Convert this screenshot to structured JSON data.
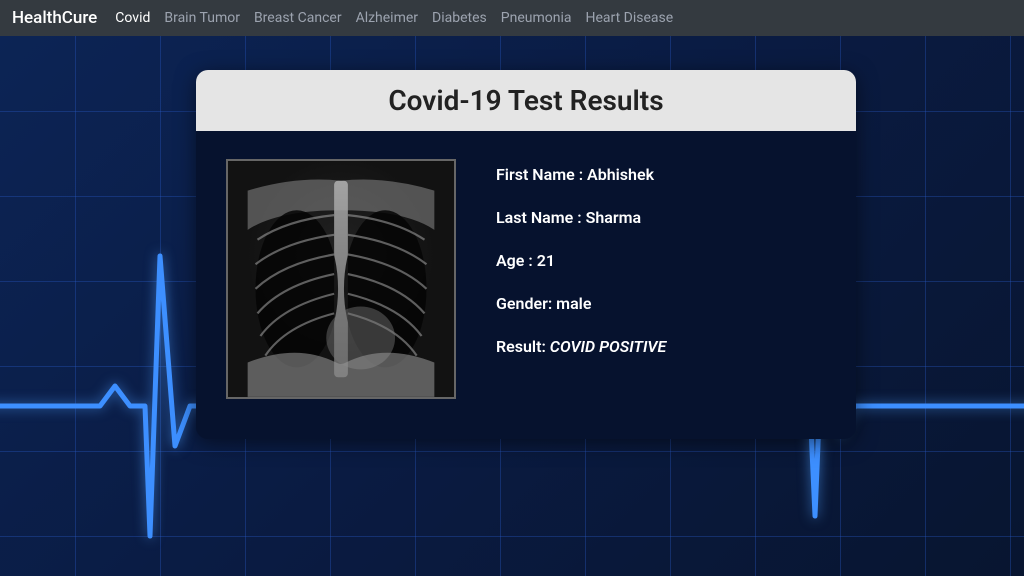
{
  "navbar": {
    "brand": "HealthCure",
    "links": [
      {
        "label": "Covid",
        "active": true
      },
      {
        "label": "Brain Tumor",
        "active": false
      },
      {
        "label": "Breast Cancer",
        "active": false
      },
      {
        "label": "Alzheimer",
        "active": false
      },
      {
        "label": "Diabetes",
        "active": false
      },
      {
        "label": "Pneumonia",
        "active": false
      },
      {
        "label": "Heart Disease",
        "active": false
      }
    ]
  },
  "card": {
    "title": "Covid-19 Test Results",
    "first_name_label": "First Name : ",
    "first_name": "Abhishek",
    "last_name_label": "Last Name : ",
    "last_name": "Sharma",
    "age_label": "Age : ",
    "age": "21",
    "gender_label": "Gender: ",
    "gender": "male",
    "result_label": "Result: ",
    "result": "COVID POSITIVE"
  }
}
